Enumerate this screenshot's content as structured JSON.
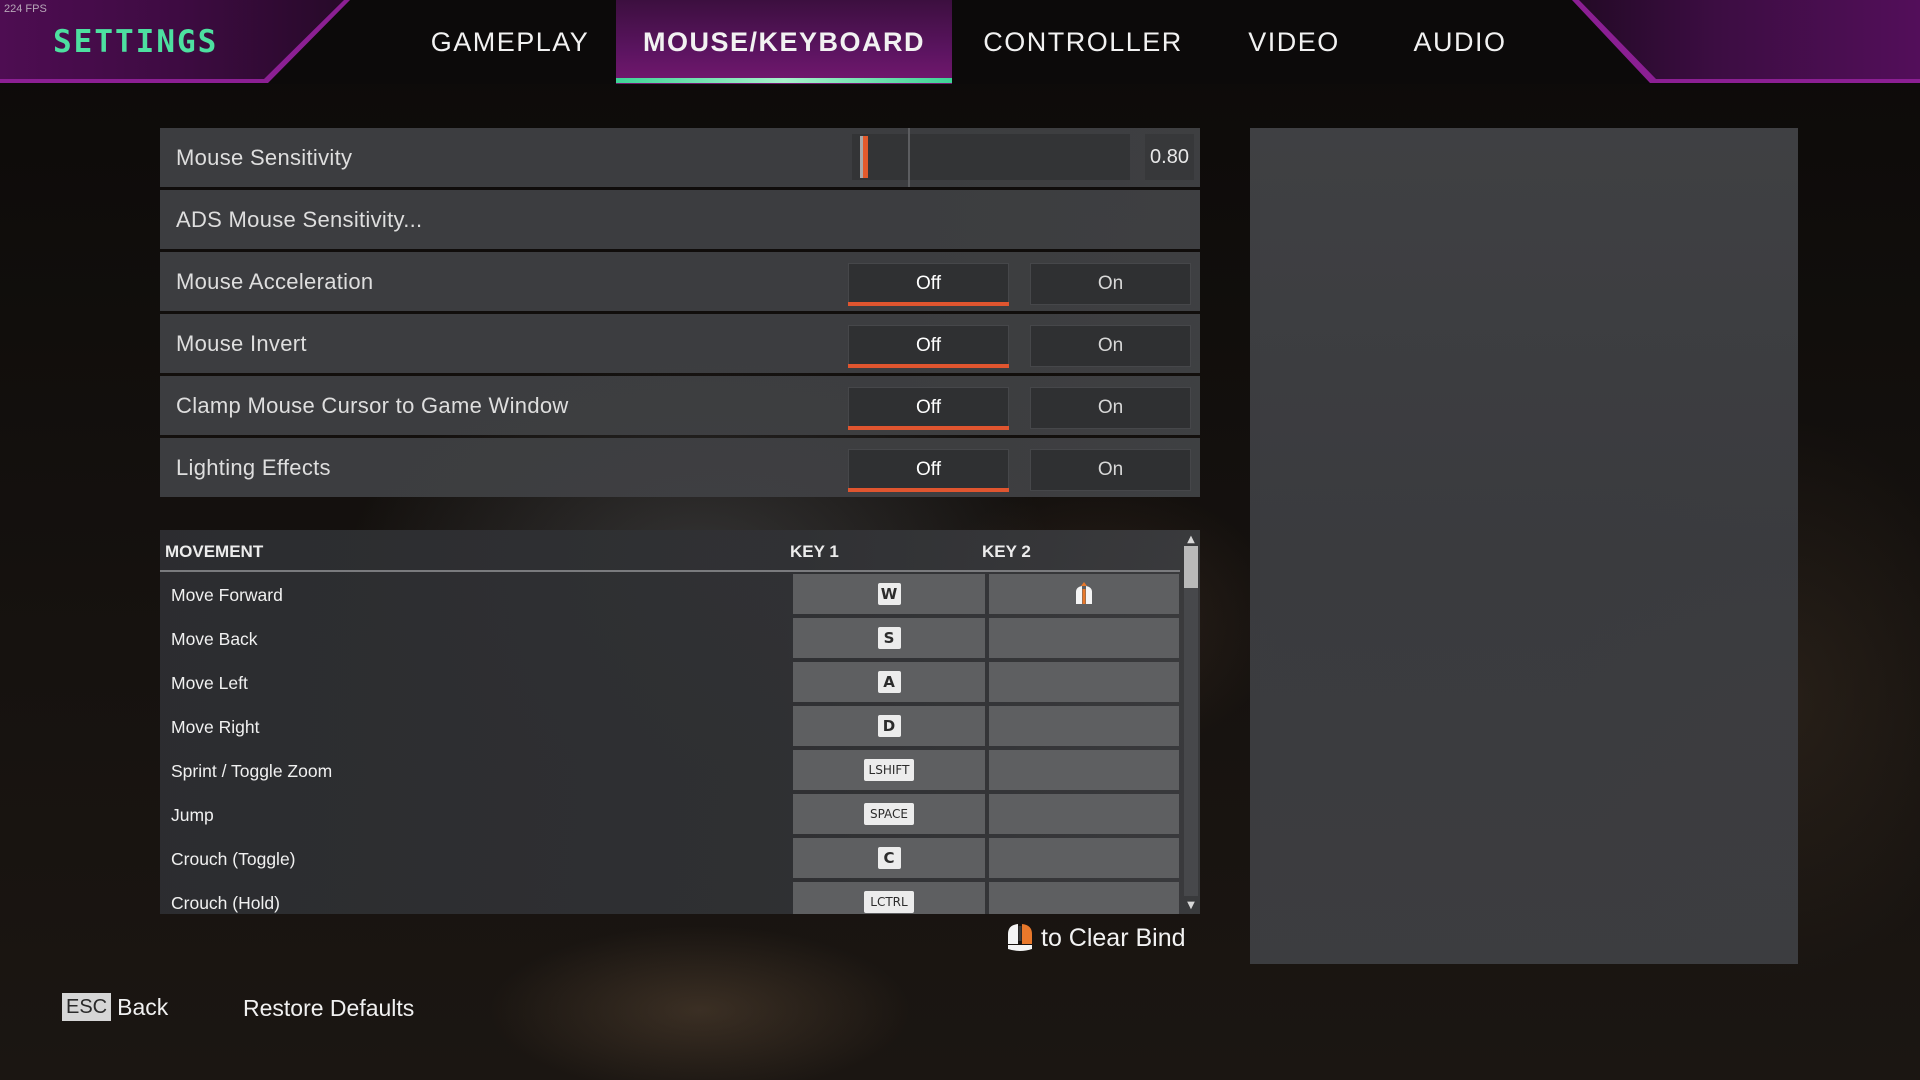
{
  "overlay": {
    "fps": "224 FPS"
  },
  "header": {
    "title": "SETTINGS",
    "tabs": [
      {
        "label": "GAMEPLAY",
        "active": false
      },
      {
        "label": "MOUSE/KEYBOARD",
        "active": true
      },
      {
        "label": "CONTROLLER",
        "active": false
      },
      {
        "label": "VIDEO",
        "active": false
      },
      {
        "label": "AUDIO",
        "active": false
      }
    ]
  },
  "colors": {
    "accent_green": "#4de0a0",
    "accent_purple": "#8b1f93",
    "selection_orange": "#e0552f"
  },
  "settings": {
    "mouse_sensitivity": {
      "label": "Mouse Sensitivity",
      "value": "0.80",
      "slider_fraction": 0.03,
      "default_marker_fraction": 0.2
    },
    "ads_sensitivity": {
      "label": "ADS Mouse Sensitivity..."
    },
    "toggles": [
      {
        "label": "Mouse Acceleration",
        "off": "Off",
        "on": "On",
        "selected": "off"
      },
      {
        "label": "Mouse Invert",
        "off": "Off",
        "on": "On",
        "selected": "off"
      },
      {
        "label": "Clamp Mouse Cursor to Game Window",
        "off": "Off",
        "on": "On",
        "selected": "off"
      },
      {
        "label": "Lighting Effects",
        "off": "Off",
        "on": "On",
        "selected": "off"
      }
    ]
  },
  "keybinds": {
    "category": "MOVEMENT",
    "key1_header": "KEY 1",
    "key2_header": "KEY 2",
    "rows": [
      {
        "action": "Move Forward",
        "key1": "W",
        "key2": "mouse-wheel-up-icon"
      },
      {
        "action": "Move Back",
        "key1": "S",
        "key2": ""
      },
      {
        "action": "Move Left",
        "key1": "A",
        "key2": ""
      },
      {
        "action": "Move Right",
        "key1": "D",
        "key2": ""
      },
      {
        "action": "Sprint / Toggle Zoom",
        "key1": "LSHIFT",
        "key2": ""
      },
      {
        "action": "Jump",
        "key1": "SPACE",
        "key2": ""
      },
      {
        "action": "Crouch (Toggle)",
        "key1": "C",
        "key2": ""
      },
      {
        "action": "Crouch (Hold)",
        "key1": "LCTRL",
        "key2": ""
      }
    ],
    "scroll_position": 0.0,
    "clear_hint": "to Clear Bind"
  },
  "footer": {
    "back_key": "ESC",
    "back_label": "Back",
    "restore_label": "Restore Defaults"
  }
}
